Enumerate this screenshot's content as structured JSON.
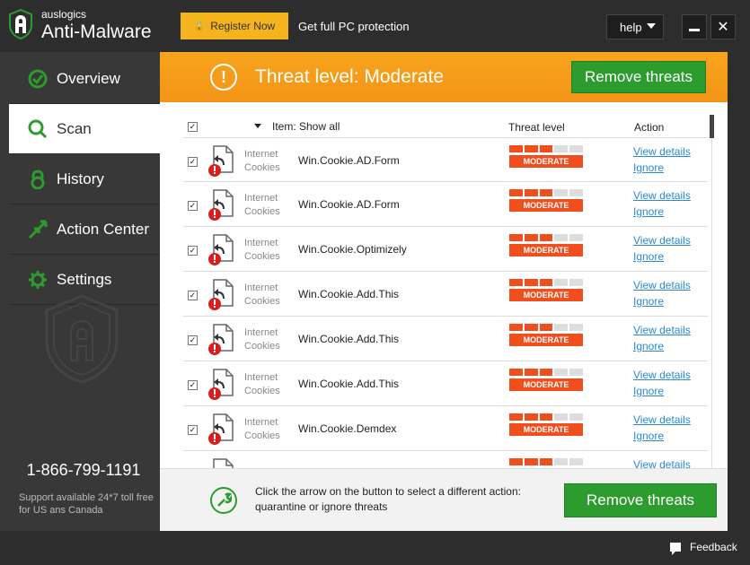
{
  "app": {
    "brand_small": "auslogics",
    "brand_name": "Anti-Malware"
  },
  "titlebar": {
    "register_label": "Register Now",
    "promo_text": "Get full PC protection",
    "help_label": "help",
    "minimize_icon": "minimize-icon",
    "close_glyph": "✕"
  },
  "sidebar": {
    "items": [
      {
        "label": "Overview",
        "icon": "check-circle-icon",
        "active": false
      },
      {
        "label": "Scan",
        "icon": "search-icon",
        "active": true
      },
      {
        "label": "History",
        "icon": "lock-icon",
        "active": false
      },
      {
        "label": "Action Center",
        "icon": "arrows-icon",
        "active": false
      },
      {
        "label": "Settings",
        "icon": "gear-icon",
        "active": false
      }
    ],
    "phone": "1-866-799-1191",
    "support_text": "Support available 24*7 toll free for US ans Canada"
  },
  "threat": {
    "title": "Threat level: Moderate",
    "remove_label": "Remove threats"
  },
  "list": {
    "header": {
      "item_label": "Item: Show all",
      "threat_label": "Threat level",
      "action_label": "Action"
    },
    "rows": [
      {
        "category": "Internet Cookies",
        "name": "Win.Cookie.AD.Form",
        "level": "MODERATE",
        "level_fraction": 0.6,
        "link1": "View details",
        "link2": "Ignore",
        "checked": true
      },
      {
        "category": "Internet Cookies",
        "name": "Win.Cookie.AD.Form",
        "level": "MODERATE",
        "level_fraction": 0.6,
        "link1": "View details",
        "link2": "Ignore",
        "checked": true
      },
      {
        "category": "Internet Cookies",
        "name": "Win.Cookie.Optimizely",
        "level": "MODERATE",
        "level_fraction": 0.6,
        "link1": "View details",
        "link2": "Ignore",
        "checked": true
      },
      {
        "category": "Internet Cookies",
        "name": "Win.Cookie.Add.This",
        "level": "MODERATE",
        "level_fraction": 0.6,
        "link1": "View details",
        "link2": "Ignore",
        "checked": true
      },
      {
        "category": "Internet Cookies",
        "name": "Win.Cookie.Add.This",
        "level": "MODERATE",
        "level_fraction": 0.6,
        "link1": "View details",
        "link2": "Ignore",
        "checked": true
      },
      {
        "category": "Internet Cookies",
        "name": "Win.Cookie.Add.This",
        "level": "MODERATE",
        "level_fraction": 0.6,
        "link1": "View details",
        "link2": "Ignore",
        "checked": true
      },
      {
        "category": "Internet Cookies",
        "name": "Win.Cookie.Demdex",
        "level": "MODERATE",
        "level_fraction": 0.6,
        "link1": "View details",
        "link2": "Ignore",
        "checked": true
      },
      {
        "category": "",
        "name": "",
        "level": "",
        "level_fraction": 0.6,
        "link1": "View details",
        "link2": "",
        "checked": true
      }
    ]
  },
  "bottom": {
    "hint": "Click the arrow on the button to select a different action: quarantine or ignore threats",
    "remove_label": "Remove threats"
  },
  "footer": {
    "feedback_label": "Feedback"
  },
  "colors": {
    "accent_orange": "#f39416",
    "action_green": "#2c9c2e",
    "threat_red": "#f04e1c",
    "link_blue": "#2a8ad4"
  }
}
